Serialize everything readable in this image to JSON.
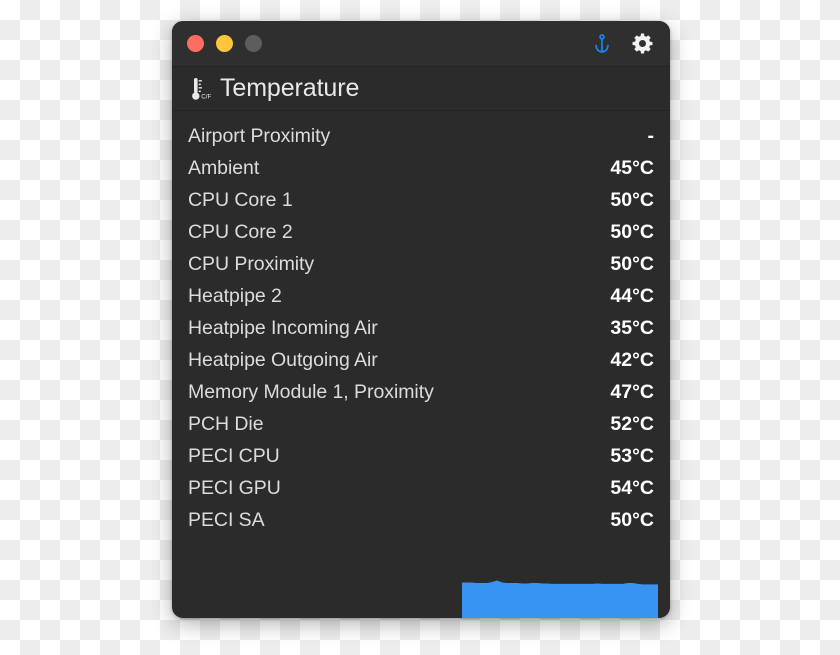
{
  "window": {
    "traffic_lights": [
      {
        "name": "close",
        "label": "Close",
        "color": "#fc6d5f"
      },
      {
        "name": "minimize",
        "label": "Minimize",
        "color": "#ffc53d"
      },
      {
        "name": "zoom",
        "label": "Zoom",
        "color": "#5d5d5d"
      }
    ],
    "background": "#2b2b2b",
    "titlebar_background": "#2f2f2f"
  },
  "titlebar": {
    "pin_icon": "anchor-icon",
    "pin_color": "#1a84f0",
    "settings_icon": "gear-icon",
    "settings_color": "#f2f2f2"
  },
  "section": {
    "icon": "thermometer-celsius-fahrenheit-icon",
    "icon_unit_label": "C/F",
    "title": "Temperature"
  },
  "sensors": [
    {
      "label": "Airport Proximity",
      "value": "-"
    },
    {
      "label": "Ambient",
      "value": "45°C"
    },
    {
      "label": "CPU Core 1",
      "value": "50°C"
    },
    {
      "label": "CPU Core 2",
      "value": "50°C"
    },
    {
      "label": "CPU Proximity",
      "value": "50°C"
    },
    {
      "label": "Heatpipe 2",
      "value": "44°C"
    },
    {
      "label": "Heatpipe Incoming Air",
      "value": "35°C"
    },
    {
      "label": "Heatpipe Outgoing Air",
      "value": "42°C"
    },
    {
      "label": "Memory Module 1, Proximity",
      "value": "47°C"
    },
    {
      "label": "PCH Die",
      "value": "52°C"
    },
    {
      "label": "PECI CPU",
      "value": "53°C"
    },
    {
      "label": "PECI GPU",
      "value": "54°C"
    },
    {
      "label": "PECI SA",
      "value": "50°C"
    }
  ],
  "chart_data": {
    "type": "area",
    "title": "",
    "xlabel": "",
    "ylabel": "",
    "color": "#3794f2",
    "ylim": [
      0,
      100
    ],
    "grid": false,
    "legend": "none",
    "x": [
      0,
      1,
      2,
      3,
      4,
      5,
      6,
      7,
      8,
      9,
      10,
      11,
      12,
      13,
      14,
      15,
      16,
      17,
      18,
      19,
      20,
      21,
      22,
      23,
      24,
      25,
      26,
      27,
      28,
      29,
      30,
      31,
      32,
      33,
      34,
      35,
      36,
      37,
      38,
      39
    ],
    "values": [
      74,
      74,
      74,
      73,
      73,
      73,
      75,
      78,
      74,
      73,
      73,
      73,
      72,
      72,
      73,
      73,
      72,
      72,
      71,
      71,
      71,
      71,
      71,
      71,
      71,
      71,
      71,
      72,
      71,
      71,
      71,
      71,
      71,
      73,
      73,
      71,
      70,
      70,
      70,
      70
    ]
  }
}
